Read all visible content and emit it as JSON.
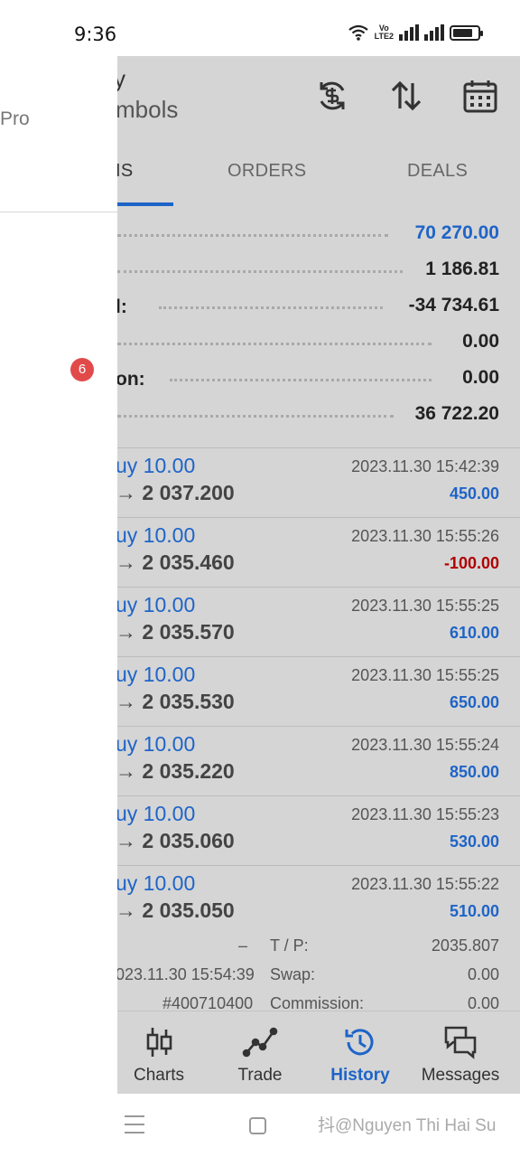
{
  "status_bar": {
    "time": "9:36",
    "volte_top": "Vo",
    "volte_bottom": "LTE2"
  },
  "drawer": {
    "app_name_fragment": "Pro",
    "badge_count": "6"
  },
  "header": {
    "title_fragment": "y",
    "subtitle_fragment": "mbols",
    "icons": [
      "currency-refresh-icon",
      "sort-arrows-icon",
      "calendar-icon"
    ]
  },
  "tabs": [
    {
      "label": "IS",
      "active": true
    },
    {
      "label": "ORDERS",
      "active": false
    },
    {
      "label": "DEALS",
      "active": false
    }
  ],
  "summary": [
    {
      "label": "",
      "value": "70 270.00",
      "color": "#1e64c8"
    },
    {
      "label": "",
      "value": "1 186.81"
    },
    {
      "label": "l:",
      "value": "-34 734.61"
    },
    {
      "label": "",
      "value": "0.00"
    },
    {
      "label": "on:",
      "value": "0.00"
    },
    {
      "label": "",
      "value": "36 722.20"
    }
  ],
  "deals": [
    {
      "side": "uy 10.00",
      "price": "→ 2 037.200",
      "time": "2023.11.30 15:42:39",
      "profit": "450.00"
    },
    {
      "side": "uy 10.00",
      "price": "→ 2 035.460",
      "time": "2023.11.30 15:55:26",
      "profit": "-100.00"
    },
    {
      "side": "uy 10.00",
      "price": "→ 2 035.570",
      "time": "2023.11.30 15:55:25",
      "profit": "610.00"
    },
    {
      "side": "uy 10.00",
      "price": "→ 2 035.530",
      "time": "2023.11.30 15:55:25",
      "profit": "650.00"
    },
    {
      "side": "uy 10.00",
      "price": "→ 2 035.220",
      "time": "2023.11.30 15:55:24",
      "profit": "850.00"
    },
    {
      "side": "uy 10.00",
      "price": "→ 2 035.060",
      "time": "2023.11.30 15:55:23",
      "profit": "530.00"
    },
    {
      "side": "uy 10.00",
      "price": "→ 2 035.050",
      "time": "2023.11.30 15:55:22",
      "profit": "510.00"
    }
  ],
  "details": {
    "row1": {
      "left": "–",
      "label": "T / P:",
      "value": "2035.807"
    },
    "row2": {
      "left": "023.11.30 15:54:39",
      "label": "Swap:",
      "value": "0.00"
    },
    "row3": {
      "left": "#400710400",
      "label": "Commission:",
      "value": "0.00"
    }
  },
  "bottom_nav": [
    {
      "label": "Charts",
      "icon": "candlestick-icon",
      "active": false
    },
    {
      "label": "Trade",
      "icon": "trade-line-icon",
      "active": false
    },
    {
      "label": "History",
      "icon": "history-clock-icon",
      "active": true
    },
    {
      "label": "Messages",
      "icon": "messages-icon",
      "active": false
    }
  ],
  "watermark": "抖@Nguyen Thi Hai Su",
  "colors": {
    "accent_blue": "#1e64c8",
    "negative_red": "#b00000",
    "badge_red": "#e24a4a",
    "panel_gray": "#d5d5d5"
  }
}
